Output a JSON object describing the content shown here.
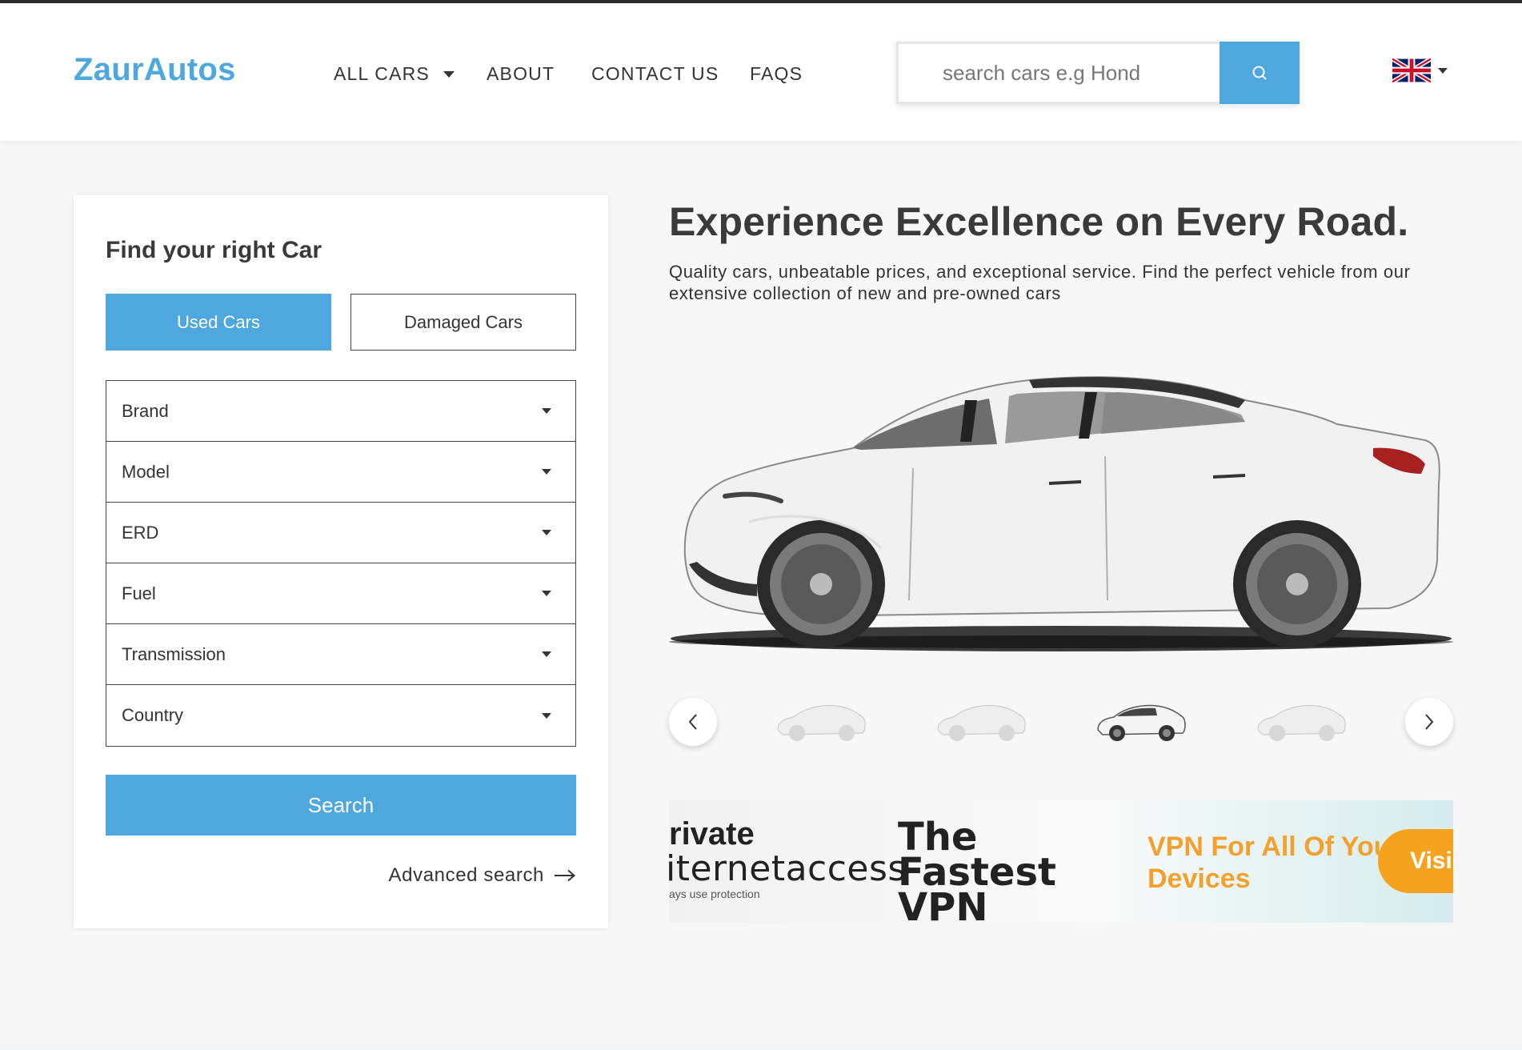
{
  "header": {
    "logo": "ZaurAutos",
    "nav": [
      {
        "label": "ALL CARS",
        "has_dropdown": true
      },
      {
        "label": "ABOUT"
      },
      {
        "label": "CONTACT US"
      },
      {
        "label": "FAQS"
      }
    ],
    "search": {
      "placeholder": "search cars e.g Hond",
      "value": ""
    },
    "language": {
      "icon": "uk-flag-icon"
    }
  },
  "finder": {
    "title": "Find your right Car",
    "tabs": [
      {
        "label": "Used Cars",
        "active": true
      },
      {
        "label": "Damaged Cars",
        "active": false
      }
    ],
    "filters": [
      "Brand",
      "Model",
      "ERD",
      "Fuel",
      "Transmission",
      "Country"
    ],
    "search_label": "Search",
    "advanced_label": "Advanced search"
  },
  "hero": {
    "title": "Experience Excellence on Every Road.",
    "text": "Quality cars, unbeatable prices, and exceptional service. Find the perfect vehicle from our extensive collection of new and pre-owned cars"
  },
  "gallery": {
    "thumbnail_count": 4,
    "active_index": 2
  },
  "ad": {
    "line1": "rivate",
    "line2": "iternetaccess",
    "line3": "ays use protection",
    "headline": "The Fastest VPN",
    "tagline": "VPN For All Of Your Devices",
    "cta": "Visi"
  },
  "colors": {
    "accent": "#4ea8df",
    "text": "#333333",
    "background": "#f7f7f7",
    "ad_orange": "#f5a31f"
  }
}
